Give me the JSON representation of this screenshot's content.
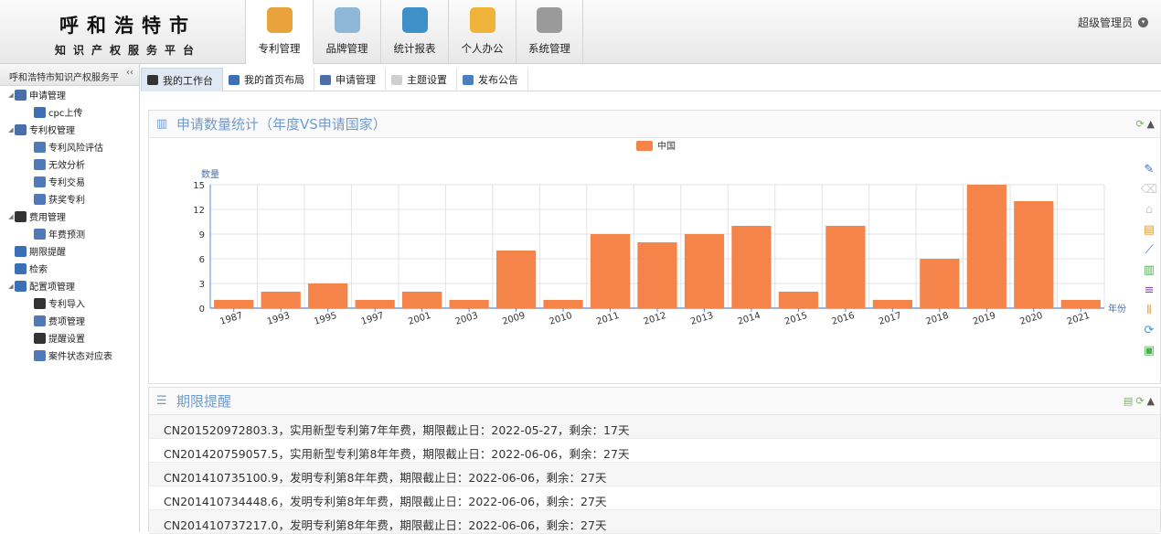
{
  "brand": {
    "line1": "呼和浩特市",
    "line2": "知识产权服务平台"
  },
  "topnav": [
    {
      "label": "专利管理",
      "icon": "patent-icon",
      "color": "#e8a33c",
      "active": true
    },
    {
      "label": "品牌管理",
      "icon": "brand-icon",
      "color": "#8fb7d8",
      "active": false
    },
    {
      "label": "统计报表",
      "icon": "stats-globe-icon",
      "color": "#3f8fc9",
      "active": false
    },
    {
      "label": "个人办公",
      "icon": "office-icon",
      "color": "#f0b33a",
      "active": false
    },
    {
      "label": "系统管理",
      "icon": "tools-icon",
      "color": "#9a9a9a",
      "active": false
    }
  ],
  "user": {
    "name": "超级管理员"
  },
  "sidebar": {
    "title": "呼和浩特市知识产权服务平",
    "collapse": "‹‹",
    "items": [
      {
        "label": "申请管理",
        "level": 0,
        "icon": "apply-folder-icon",
        "color": "#4a6fa8",
        "toggle": "◢"
      },
      {
        "label": "cpc上传",
        "level": 1,
        "icon": "upload-arrow-icon",
        "color": "#3b6fb6",
        "toggle": ""
      },
      {
        "label": "专利权管理",
        "level": 0,
        "icon": "patent-right-icon",
        "color": "#4a6fa8",
        "toggle": "◢"
      },
      {
        "label": "专利风险评估",
        "level": 1,
        "icon": "risk-doc-icon",
        "color": "#4f79b9",
        "toggle": ""
      },
      {
        "label": "无效分析",
        "level": 1,
        "icon": "invalid-doc-icon",
        "color": "#4f79b9",
        "toggle": ""
      },
      {
        "label": "专利交易",
        "level": 1,
        "icon": "trade-doc-icon",
        "color": "#4f79b9",
        "toggle": ""
      },
      {
        "label": "获奖专利",
        "level": 1,
        "icon": "award-doc-icon",
        "color": "#4f79b9",
        "toggle": ""
      },
      {
        "label": "费用管理",
        "level": 0,
        "icon": "yen-icon",
        "color": "#333333",
        "toggle": "◢"
      },
      {
        "label": "年费预测",
        "level": 1,
        "icon": "forecast-icon",
        "color": "#4f79b9",
        "toggle": ""
      },
      {
        "label": "期限提醒",
        "level": 0,
        "icon": "deadline-icon",
        "color": "#3b6fb6",
        "toggle": ""
      },
      {
        "label": "检索",
        "level": 0,
        "icon": "search-icon",
        "color": "#3b6fb6",
        "toggle": ""
      },
      {
        "label": "配置项管理",
        "level": 0,
        "icon": "gear-icon",
        "color": "#3b6fb6",
        "toggle": "◢"
      },
      {
        "label": "专利导入",
        "level": 1,
        "icon": "import-icon",
        "color": "#333333",
        "toggle": ""
      },
      {
        "label": "费项管理",
        "level": 1,
        "icon": "fee-item-icon",
        "color": "#4f79b9",
        "toggle": ""
      },
      {
        "label": "提醒设置",
        "level": 1,
        "icon": "clock-icon",
        "color": "#333333",
        "toggle": ""
      },
      {
        "label": "案件状态对应表",
        "level": 1,
        "icon": "status-table-icon",
        "color": "#4f79b9",
        "toggle": ""
      }
    ]
  },
  "tabs": [
    {
      "label": "我的工作台",
      "icon": "monitor-icon",
      "color": "#333333",
      "active": true
    },
    {
      "label": "我的首页布局",
      "icon": "user-icon",
      "color": "#3b6fb6",
      "active": false
    },
    {
      "label": "申请管理",
      "icon": "apply-icon",
      "color": "#4a6fa8",
      "active": false
    },
    {
      "label": "主题设置",
      "icon": "theme-icon",
      "color": "#cfcfcf",
      "active": false
    },
    {
      "label": "发布公告",
      "icon": "notice-icon",
      "color": "#4a7fc0",
      "active": false
    }
  ],
  "stats_panel": {
    "title": "申请数量统计（年度VS申请国家）",
    "tools": [
      "refresh-icon",
      "collapse-up-icon"
    ]
  },
  "chart_data": {
    "type": "bar",
    "categories": [
      "1987",
      "1993",
      "1995",
      "1997",
      "2001",
      "2003",
      "2009",
      "2010",
      "2011",
      "2012",
      "2013",
      "2014",
      "2015",
      "2016",
      "2017",
      "2018",
      "2019",
      "2020",
      "2021"
    ],
    "series": [
      {
        "name": "中国",
        "values": [
          1,
          2,
          3,
          1,
          2,
          1,
          7,
          1,
          9,
          8,
          9,
          10,
          2,
          10,
          1,
          6,
          15,
          13,
          1
        ],
        "color": "#f5844a"
      }
    ],
    "xlabel": "年份",
    "ylabel": "数量",
    "ylim": [
      0,
      15
    ],
    "yticks": [
      0,
      3,
      6,
      9,
      12,
      15
    ],
    "grid": true,
    "legend": "top-center"
  },
  "chart_tools": [
    {
      "icon": "pen-icon",
      "color": "#3b6fb6"
    },
    {
      "icon": "eraser-icon",
      "color": "#cfcfcf"
    },
    {
      "icon": "home-icon",
      "color": "#cfcfcf"
    },
    {
      "icon": "data-view-icon",
      "color": "#e89a3c"
    },
    {
      "icon": "line-chart-icon",
      "color": "#3b6fb6"
    },
    {
      "icon": "bar-chart-icon",
      "color": "#4caf50"
    },
    {
      "icon": "stack-icon",
      "color": "#7b4fa8"
    },
    {
      "icon": "tiled-icon",
      "color": "#e89a3c"
    },
    {
      "icon": "restore-icon",
      "color": "#3b9ad9"
    },
    {
      "icon": "save-image-icon",
      "color": "#4caf50"
    }
  ],
  "deadline_panel": {
    "title": "期限提醒",
    "tools": [
      "table-icon",
      "refresh-icon",
      "collapse-up-icon"
    ],
    "rows": [
      "CN201520972803.3，实用新型专利第7年年费，期限截止日：2022-05-27，剩余：17天",
      "CN201420759057.5，实用新型专利第8年年费，期限截止日：2022-06-06，剩余：27天",
      "CN201410735100.9，发明专利第8年年费，期限截止日：2022-06-06，剩余：27天",
      "CN201410734448.6，发明专利第8年年费，期限截止日：2022-06-06，剩余：27天",
      "CN201410737217.0，发明专利第8年年费，期限截止日：2022-06-06，剩余：27天"
    ]
  }
}
